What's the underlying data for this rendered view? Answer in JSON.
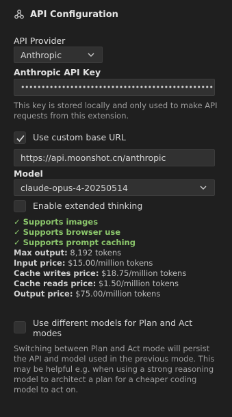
{
  "header": {
    "title": "API Configuration",
    "icon": "webhook-icon"
  },
  "provider": {
    "label": "API Provider",
    "value": "Anthropic"
  },
  "api_key": {
    "label": "Anthropic API Key",
    "value": "••••••••••••••••••••••••••••••••••••••••••••••••••",
    "help": "This key is stored locally and only used to make API requests from this extension."
  },
  "base_url": {
    "checkbox_label": "Use custom base URL",
    "checked": true,
    "value": "https://api.moonshot.cn/anthropic"
  },
  "model": {
    "label": "Model",
    "value": "claude-opus-4-20250514"
  },
  "extended_thinking": {
    "label": "Enable extended thinking",
    "checked": false
  },
  "supports": [
    "✓ Supports images",
    "✓ Supports browser use",
    "✓ Supports prompt caching"
  ],
  "specs": [
    {
      "label": "Max output:",
      "value": "8,192 tokens"
    },
    {
      "label": "Input price:",
      "value": "$15.00/million tokens"
    },
    {
      "label": "Cache writes price:",
      "value": "$18.75/million tokens"
    },
    {
      "label": "Cache reads price:",
      "value": "$1.50/million tokens"
    },
    {
      "label": "Output price:",
      "value": "$75.00/million tokens"
    }
  ],
  "plan_act": {
    "label": "Use different models for Plan and Act modes",
    "checked": false,
    "help": "Switching between Plan and Act mode will persist the API and model used in the previous mode. This may be helpful e.g. when using a strong reasoning model to architect a plan for a cheaper coding model to act on."
  }
}
